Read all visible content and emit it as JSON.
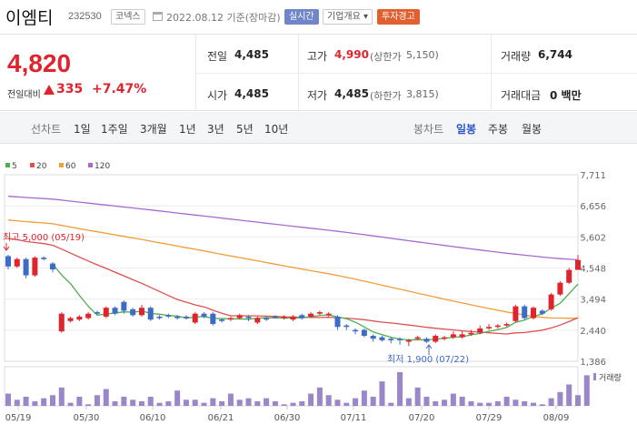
{
  "header": {
    "name": "이엠티",
    "code": "232530",
    "market": "코넥스",
    "date": "2022.08.12 기준(장마감)",
    "live": "실시간",
    "company_info": "기업개요 ▾",
    "warning": "투자경고"
  },
  "summary": {
    "price": "4,820",
    "change_label": "전일대비",
    "change": "335",
    "change_rate": "+7.47%",
    "prev_label": "전일",
    "prev": "4,485",
    "high_label": "고가",
    "high": "4,990",
    "upper_label": "(상한가",
    "upper": "5,150)",
    "volume_label": "거래량",
    "volume": "6,744",
    "open_label": "시가",
    "open": "4,485",
    "low_label": "저가",
    "low": "4,485",
    "lower_label": "(하한가",
    "lower": "3,815)",
    "amount_label": "거래대금",
    "amount": "0 백만"
  },
  "toolbar": {
    "line_chart": "선차트",
    "periods": [
      "1일",
      "1주일",
      "3개월",
      "1년",
      "3년",
      "5년",
      "10년"
    ],
    "candle_chart": "봉차트",
    "candle_periods": [
      "일봉",
      "주봉",
      "월봉"
    ],
    "active_candle": "일봉"
  },
  "colors": {
    "up": "#e0242e",
    "down": "#3d6bc6",
    "ma5": "#4caf50",
    "ma20": "#e05050",
    "ma60": "#f39c3a",
    "ma120": "#a66ad0",
    "volume": "#9a86c9"
  },
  "chart_data": {
    "type": "candlestick",
    "legend": [
      "5",
      "20",
      "60",
      "120"
    ],
    "y_ticks": [
      7711,
      6656,
      5602,
      4548,
      3494,
      2440,
      1386
    ],
    "x_ticks": [
      "05/19",
      "05/30",
      "06/10",
      "06/21",
      "06/30",
      "07/11",
      "07/20",
      "07/29",
      "08/09"
    ],
    "high_annotation": "최고 5,000 (05/19)",
    "low_annotation": "최저 1,900 (07/22)",
    "volume_label": "거래량",
    "candles": [
      {
        "o": 4950,
        "c": 4600,
        "h": 5000,
        "l": 4500
      },
      {
        "o": 4600,
        "c": 4850,
        "h": 4900,
        "l": 4550
      },
      {
        "o": 4850,
        "c": 4300,
        "h": 4900,
        "l": 4200
      },
      {
        "o": 4300,
        "c": 4900,
        "h": 4950,
        "l": 4250
      },
      {
        "o": 4900,
        "c": 4850,
        "h": 4950,
        "l": 4800
      },
      {
        "o": 4700,
        "c": 4500,
        "h": 4750,
        "l": 4400
      },
      {
        "o": 2400,
        "c": 3000,
        "h": 3050,
        "l": 2350
      },
      {
        "o": 2750,
        "c": 2850,
        "h": 2900,
        "l": 2700
      },
      {
        "o": 2800,
        "c": 2900,
        "h": 2950,
        "l": 2750
      },
      {
        "o": 2850,
        "c": 3000,
        "h": 3050,
        "l": 2800
      },
      {
        "o": 3050,
        "c": 3000,
        "h": 3100,
        "l": 2950
      },
      {
        "o": 2900,
        "c": 3200,
        "h": 3250,
        "l": 2850
      },
      {
        "o": 3200,
        "c": 3000,
        "h": 3250,
        "l": 2950
      },
      {
        "o": 3400,
        "c": 3100,
        "h": 3450,
        "l": 3000
      },
      {
        "o": 3150,
        "c": 2950,
        "h": 3200,
        "l": 2900
      },
      {
        "o": 2950,
        "c": 3200,
        "h": 3300,
        "l": 2900
      },
      {
        "o": 3200,
        "c": 2800,
        "h": 3250,
        "l": 2750
      },
      {
        "o": 2900,
        "c": 2850,
        "h": 2950,
        "l": 2800
      },
      {
        "o": 2950,
        "c": 2900,
        "h": 3000,
        "l": 2850
      },
      {
        "o": 2900,
        "c": 2850,
        "h": 2950,
        "l": 2800
      },
      {
        "o": 2900,
        "c": 2850,
        "h": 2950,
        "l": 2800
      },
      {
        "o": 2700,
        "c": 3000,
        "h": 3050,
        "l": 2650
      },
      {
        "o": 3000,
        "c": 2900,
        "h": 3050,
        "l": 2850
      },
      {
        "o": 3000,
        "c": 2650,
        "h": 3050,
        "l": 2600
      },
      {
        "o": 2800,
        "c": 2750,
        "h": 2850,
        "l": 2700
      },
      {
        "o": 2800,
        "c": 2850,
        "h": 2900,
        "l": 2750
      },
      {
        "o": 2850,
        "c": 2950,
        "h": 3000,
        "l": 2800
      },
      {
        "o": 2900,
        "c": 2850,
        "h": 2950,
        "l": 2750
      },
      {
        "o": 2700,
        "c": 2850,
        "h": 2900,
        "l": 2650
      },
      {
        "o": 2850,
        "c": 2800,
        "h": 2900,
        "l": 2750
      },
      {
        "o": 2900,
        "c": 2850,
        "h": 2950,
        "l": 2850
      },
      {
        "o": 2850,
        "c": 2900,
        "h": 2950,
        "l": 2800
      },
      {
        "o": 2800,
        "c": 2900,
        "h": 2950,
        "l": 2750
      },
      {
        "o": 2950,
        "c": 2850,
        "h": 3000,
        "l": 2800
      },
      {
        "o": 2900,
        "c": 3000,
        "h": 3050,
        "l": 2850
      },
      {
        "o": 3000,
        "c": 3050,
        "h": 3100,
        "l": 2950
      },
      {
        "o": 2950,
        "c": 3000,
        "h": 3050,
        "l": 2900
      },
      {
        "o": 2900,
        "c": 2550,
        "h": 2950,
        "l": 2450
      },
      {
        "o": 2600,
        "c": 2550,
        "h": 2650,
        "l": 2450
      },
      {
        "o": 2450,
        "c": 2400,
        "h": 2500,
        "l": 2300
      },
      {
        "o": 2450,
        "c": 2250,
        "h": 2500,
        "l": 2200
      },
      {
        "o": 2250,
        "c": 2150,
        "h": 2300,
        "l": 2050
      },
      {
        "o": 2200,
        "c": 2100,
        "h": 2250,
        "l": 2050
      },
      {
        "o": 2150,
        "c": 2100,
        "h": 2200,
        "l": 2000
      },
      {
        "o": 2150,
        "c": 2100,
        "h": 2200,
        "l": 1950
      },
      {
        "o": 2050,
        "c": 2100,
        "h": 2150,
        "l": 1900
      },
      {
        "o": 2150,
        "c": 2200,
        "h": 2250,
        "l": 2100
      },
      {
        "o": 2150,
        "c": 2050,
        "h": 2200,
        "l": 2000
      },
      {
        "o": 2050,
        "c": 2250,
        "h": 2300,
        "l": 2000
      },
      {
        "o": 2150,
        "c": 2200,
        "h": 2250,
        "l": 2100
      },
      {
        "o": 2200,
        "c": 2300,
        "h": 2400,
        "l": 2150
      },
      {
        "o": 2200,
        "c": 2300,
        "h": 2400,
        "l": 2150
      },
      {
        "o": 2300,
        "c": 2350,
        "h": 2450,
        "l": 2250
      },
      {
        "o": 2350,
        "c": 2500,
        "h": 2600,
        "l": 2300
      },
      {
        "o": 2500,
        "c": 2550,
        "h": 2650,
        "l": 2450
      },
      {
        "o": 2550,
        "c": 2600,
        "h": 2650,
        "l": 2500
      },
      {
        "o": 2600,
        "c": 2650,
        "h": 2700,
        "l": 2550
      },
      {
        "o": 2750,
        "c": 3250,
        "h": 3300,
        "l": 2700
      },
      {
        "o": 3250,
        "c": 2850,
        "h": 3300,
        "l": 2800
      },
      {
        "o": 2850,
        "c": 3200,
        "h": 3250,
        "l": 2800
      },
      {
        "o": 3100,
        "c": 3000,
        "h": 3150,
        "l": 2950
      },
      {
        "o": 3150,
        "c": 3650,
        "h": 3700,
        "l": 3100
      },
      {
        "o": 3650,
        "c": 4050,
        "h": 4100,
        "l": 3600
      },
      {
        "o": 4050,
        "c": 4485,
        "h": 4550,
        "l": 4000
      },
      {
        "o": 4485,
        "c": 4820,
        "h": 4990,
        "l": 4485
      }
    ],
    "volumes": [
      8,
      4,
      6,
      3,
      5,
      7,
      12,
      2,
      6,
      1,
      7,
      11,
      3,
      6,
      4,
      3,
      6,
      2,
      3,
      10,
      4,
      4,
      2,
      5,
      3,
      8,
      4,
      5,
      3,
      5,
      3,
      1,
      2,
      3,
      8,
      12,
      7,
      4,
      2,
      5,
      10,
      6,
      16,
      2,
      22,
      5,
      12,
      6,
      3,
      4,
      8,
      6,
      3,
      2,
      2,
      3,
      6,
      4,
      3,
      2,
      1,
      5,
      9,
      14,
      7,
      20
    ]
  }
}
